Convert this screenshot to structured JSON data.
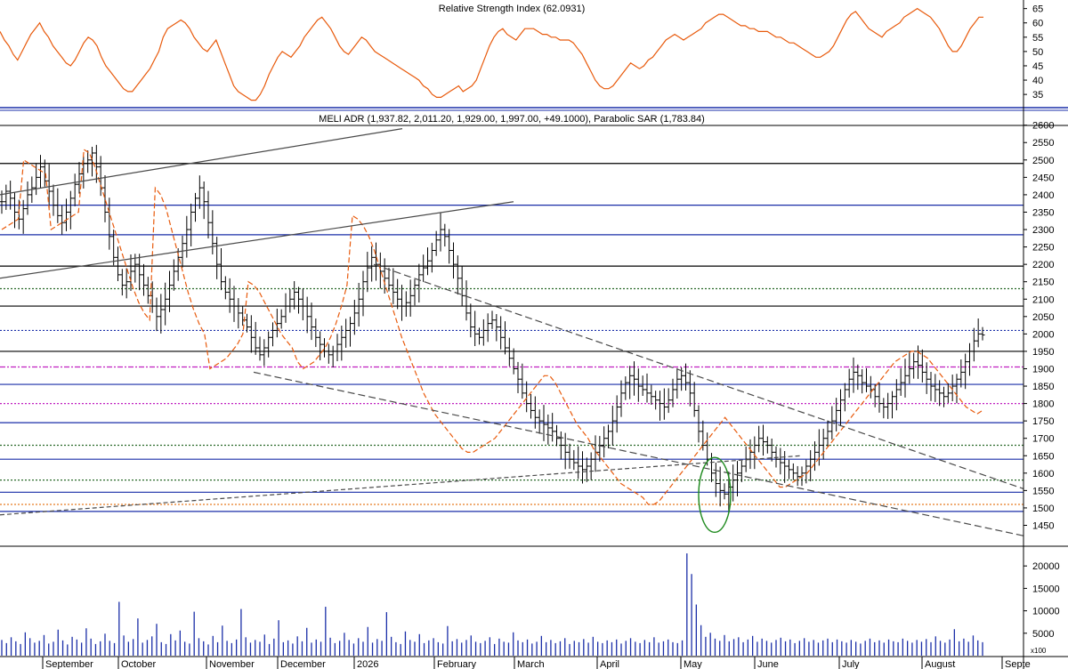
{
  "chart_data": [
    {
      "type": "line",
      "title": "Relative Strength Index (62.0931)",
      "y_ticks": [
        35,
        40,
        45,
        50,
        55,
        60,
        65
      ],
      "ylim": [
        31,
        68
      ],
      "series": [
        {
          "color": "#e85a0c",
          "values": [
            57,
            54,
            52,
            49,
            47,
            50,
            53,
            56,
            58,
            60,
            57,
            55,
            52,
            50,
            48,
            46,
            45,
            47,
            50,
            53,
            55,
            54,
            52,
            48,
            45,
            43,
            41,
            39,
            37,
            36,
            36,
            38,
            40,
            42,
            44,
            47,
            50,
            55,
            58,
            59,
            60,
            61,
            60,
            58,
            55,
            53,
            51,
            50,
            52,
            54,
            50,
            46,
            42,
            38,
            36,
            35,
            34,
            33,
            33,
            35,
            38,
            42,
            45,
            48,
            50,
            49,
            48,
            50,
            52,
            55,
            57,
            59,
            61,
            62,
            60,
            58,
            55,
            52,
            50,
            49,
            51,
            53,
            55,
            54,
            52,
            50,
            49,
            48,
            47,
            46,
            45,
            44,
            43,
            42,
            41,
            40,
            38,
            37,
            35,
            34,
            34,
            35,
            36,
            37,
            38,
            36,
            37,
            38,
            40,
            44,
            48,
            52,
            55,
            57,
            58,
            56,
            55,
            54,
            56,
            58,
            58,
            58,
            57,
            56,
            56,
            55,
            55,
            54,
            54,
            54,
            53,
            51,
            49,
            46,
            43,
            40,
            38,
            37,
            37,
            38,
            40,
            42,
            44,
            46,
            45,
            44,
            45,
            47,
            48,
            50,
            52,
            54,
            55,
            56,
            55,
            54,
            55,
            56,
            57,
            58,
            60,
            61,
            62,
            63,
            63,
            62,
            61,
            60,
            59,
            59,
            58,
            58,
            57,
            57,
            57,
            56,
            55,
            55,
            54,
            53,
            53,
            52,
            51,
            50,
            49,
            48,
            48,
            49,
            50,
            52,
            55,
            58,
            61,
            63,
            64,
            62,
            60,
            58,
            57,
            56,
            55,
            57,
            58,
            59,
            60,
            62,
            63,
            64,
            65,
            64,
            63,
            62,
            60,
            58,
            55,
            52,
            50,
            50,
            52,
            55,
            58,
            60,
            62,
            62
          ]
        }
      ]
    },
    {
      "type": "line",
      "title": "MELI ADR (1,937.82, 2,011.20, 1,929.00, 1,997.00, +49.1000), Parabolic SAR (1,783.84)",
      "y_ticks": [
        1450,
        1500,
        1550,
        1600,
        1650,
        1700,
        1750,
        1800,
        1850,
        1900,
        1950,
        2000,
        2050,
        2100,
        2150,
        2200,
        2250,
        2300,
        2350,
        2400,
        2450,
        2500,
        2550,
        2600
      ],
      "ylim": [
        1395,
        2635
      ],
      "x_labels": [
        "September",
        "October",
        "November",
        "December",
        "2026",
        "February",
        "March",
        "April",
        "May",
        "June",
        "July",
        "August",
        "Septe"
      ],
      "series": [
        {
          "name": "MELI ADR",
          "color": "#000000",
          "values": [
            2380,
            2410,
            2390,
            2350,
            2330,
            2360,
            2400,
            2420,
            2450,
            2480,
            2440,
            2410,
            2370,
            2340,
            2320,
            2350,
            2390,
            2430,
            2460,
            2490,
            2500,
            2520,
            2480,
            2420,
            2350,
            2280,
            2220,
            2170,
            2140,
            2150,
            2180,
            2200,
            2170,
            2140,
            2110,
            2080,
            2050,
            2070,
            2100,
            2140,
            2180,
            2220,
            2260,
            2300,
            2350,
            2390,
            2420,
            2380,
            2320,
            2260,
            2200,
            2150,
            2120,
            2100,
            2080,
            2060,
            2040,
            2020,
            1990,
            1960,
            1940,
            1960,
            1990,
            2010,
            2030,
            2050,
            2080,
            2100,
            2120,
            2100,
            2080,
            2050,
            2020,
            1990,
            1970,
            1950,
            1940,
            1950,
            1970,
            1990,
            2010,
            2030,
            2060,
            2100,
            2150,
            2190,
            2220,
            2200,
            2180,
            2160,
            2140,
            2120,
            2100,
            2080,
            2090,
            2110,
            2140,
            2170,
            2190,
            2210,
            2240,
            2270,
            2300,
            2280,
            2240,
            2200,
            2160,
            2110,
            2060,
            2020,
            2000,
            1990,
            2010,
            2030,
            2040,
            2020,
            1990,
            1960,
            1930,
            1900,
            1870,
            1830,
            1800,
            1780,
            1760,
            1750,
            1740,
            1730,
            1720,
            1700,
            1680,
            1660,
            1640,
            1630,
            1620,
            1610,
            1620,
            1640,
            1660,
            1680,
            1700,
            1720,
            1750,
            1790,
            1830,
            1860,
            1880,
            1870,
            1850,
            1840,
            1830,
            1820,
            1810,
            1800,
            1790,
            1810,
            1840,
            1870,
            1880,
            1860,
            1830,
            1780,
            1720,
            1680,
            1640,
            1600,
            1570,
            1550,
            1540,
            1560,
            1580,
            1600,
            1620,
            1640,
            1660,
            1680,
            1700,
            1690,
            1680,
            1660,
            1640,
            1630,
            1620,
            1610,
            1600,
            1590,
            1600,
            1620,
            1640,
            1660,
            1680,
            1700,
            1720,
            1750,
            1780,
            1810,
            1840,
            1870,
            1890,
            1880,
            1860,
            1850,
            1840,
            1820,
            1800,
            1790,
            1800,
            1820,
            1840,
            1860,
            1880,
            1900,
            1920,
            1910,
            1890,
            1870,
            1850,
            1840,
            1830,
            1820,
            1830,
            1850,
            1870,
            1890,
            1920,
            1950,
            1980,
            2000,
            1997
          ]
        },
        {
          "name": "Parabolic SAR",
          "color": "#e85a0c",
          "values": [
            2300,
            2310,
            2320,
            2330,
            2500,
            2490,
            2480,
            2470,
            2460,
            2300,
            2310,
            2320,
            2330,
            2340,
            2350,
            2530,
            2520,
            2480,
            2430,
            2380,
            2330,
            2280,
            2230,
            2180,
            2130,
            2090,
            2060,
            2040,
            2420,
            2400,
            2360,
            2300,
            2240,
            2180,
            2120,
            2070,
            2030,
            2000,
            1900,
            1910,
            1920,
            1930,
            1950,
            1970,
            2000,
            2150,
            2140,
            2120,
            2090,
            2060,
            2030,
            2000,
            1980,
            1960,
            1920,
            1900,
            1910,
            1920,
            1940,
            1960,
            1990,
            2030,
            2080,
            2140,
            2340,
            2330,
            2310,
            2280,
            2240,
            2190,
            2140,
            2090,
            2040,
            1990,
            1950,
            1910,
            1870,
            1830,
            1800,
            1770,
            1750,
            1730,
            1710,
            1690,
            1670,
            1660,
            1660,
            1670,
            1680,
            1690,
            1700,
            1720,
            1740,
            1760,
            1780,
            1800,
            1820,
            1840,
            1860,
            1880,
            1880,
            1860,
            1830,
            1800,
            1770,
            1740,
            1720,
            1700,
            1670,
            1650,
            1630,
            1610,
            1590,
            1570,
            1560,
            1550,
            1540,
            1530,
            1510,
            1510,
            1520,
            1540,
            1560,
            1580,
            1600,
            1620,
            1640,
            1660,
            1680,
            1700,
            1720,
            1740,
            1760,
            1740,
            1720,
            1700,
            1680,
            1660,
            1640,
            1620,
            1600,
            1580,
            1560,
            1560,
            1570,
            1580,
            1590,
            1600,
            1620,
            1640,
            1660,
            1680,
            1700,
            1720,
            1740,
            1760,
            1780,
            1800,
            1820,
            1840,
            1860,
            1880,
            1900,
            1920,
            1930,
            1940,
            1950,
            1950,
            1940,
            1930,
            1910,
            1890,
            1870,
            1850,
            1830,
            1810,
            1790,
            1780,
            1770,
            1780
          ]
        }
      ],
      "horizontal_levels": [
        {
          "value": 2490,
          "style": "solid",
          "color": "#000000"
        },
        {
          "value": 2370,
          "style": "solid",
          "color": "#1a2ea8"
        },
        {
          "value": 2285,
          "style": "solid",
          "color": "#1a2ea8"
        },
        {
          "value": 2195,
          "style": "solid",
          "color": "#000000"
        },
        {
          "value": 2130,
          "style": "dotted",
          "color": "#2a6a2a"
        },
        {
          "value": 2080,
          "style": "solid",
          "color": "#000000"
        },
        {
          "value": 2010,
          "style": "dotted",
          "color": "#1a2ea8"
        },
        {
          "value": 1950,
          "style": "solid",
          "color": "#000000"
        },
        {
          "value": 1905,
          "style": "dashdot",
          "color": "#c020c0"
        },
        {
          "value": 1855,
          "style": "solid",
          "color": "#1a2ea8"
        },
        {
          "value": 1800,
          "style": "dotted",
          "color": "#c020c0"
        },
        {
          "value": 1745,
          "style": "solid",
          "color": "#1a2ea8"
        },
        {
          "value": 1680,
          "style": "dotted",
          "color": "#2a6a2a"
        },
        {
          "value": 1640,
          "style": "solid",
          "color": "#1a2ea8"
        },
        {
          "value": 1580,
          "style": "dotted",
          "color": "#2a6a2a"
        },
        {
          "value": 1545,
          "style": "solid",
          "color": "#1a2ea8"
        },
        {
          "value": 1510,
          "style": "dotted",
          "color": "#e87a20"
        },
        {
          "value": 1490,
          "style": "solid",
          "color": "#1a2ea8"
        }
      ]
    },
    {
      "type": "bar",
      "title": "",
      "y_ticks": [
        5000,
        10000,
        15000,
        20000
      ],
      "unit_label": "x100",
      "ylim": [
        0,
        24000
      ],
      "series": [
        {
          "color": "#1a2ea8",
          "values": [
            3500,
            2800,
            4100,
            3200,
            2600,
            5200,
            3900,
            2900,
            3300,
            4600,
            2700,
            3100,
            5800,
            3400,
            2500,
            4200,
            3600,
            2900,
            6100,
            3800,
            2600,
            3200,
            4900,
            3300,
            2800,
            12000,
            4500,
            3100,
            3700,
            8300,
            2900,
            3500,
            4300,
            7100,
            3000,
            2600,
            4800,
            3400,
            5600,
            3100,
            2700,
            9800,
            3900,
            3200,
            2500,
            4400,
            3000,
            6700,
            3300,
            2800,
            3600,
            10400,
            4100,
            2900,
            3500,
            3100,
            4700,
            2600,
            3800,
            7900,
            3000,
            3400,
            2700,
            4300,
            3200,
            6200,
            2900,
            3600,
            3100,
            10900,
            4000,
            2800,
            3300,
            5100,
            3500,
            2700,
            3900,
            3100,
            6400,
            2900,
            3700,
            3300,
            9700,
            4200,
            3000,
            2600,
            5400,
            3500,
            3100,
            4800,
            2800,
            3400,
            3900,
            3000,
            2700,
            6600,
            3200,
            3700,
            2900,
            3500,
            4500,
            3100,
            2800,
            3300,
            4100,
            2600,
            3800,
            3100,
            2900,
            5200,
            3400,
            3000,
            3600,
            2700,
            3100,
            4400,
            3000,
            3500,
            2800,
            3200,
            3900,
            2600,
            3300,
            3000,
            3700,
            2900,
            4200,
            3100,
            2800,
            3400,
            3000,
            3600,
            2700,
            3300,
            3900,
            3100,
            2800,
            3500,
            3000,
            4100,
            2900,
            3200,
            3600,
            3000,
            2800,
            3400,
            22800,
            18200,
            11400,
            6800,
            4200,
            5100,
            3800,
            3300,
            4600,
            3200,
            3700,
            4100,
            3000,
            3600,
            4400,
            3100,
            3800,
            3300,
            2900,
            3500,
            4000,
            3200,
            3600,
            2800,
            3300,
            3900,
            3100,
            3500,
            2900,
            3400,
            3800,
            3000,
            3600,
            3200,
            2900,
            3500,
            3100,
            2700,
            3300,
            3800,
            3000,
            3400,
            2900,
            3600,
            3200,
            3000,
            3800,
            3300,
            2900,
            3500,
            3100,
            3700,
            3000,
            4300,
            3300,
            2900,
            3600,
            5900,
            3200,
            3800,
            3100,
            4500,
            3400,
            3000
          ]
        }
      ]
    }
  ]
}
